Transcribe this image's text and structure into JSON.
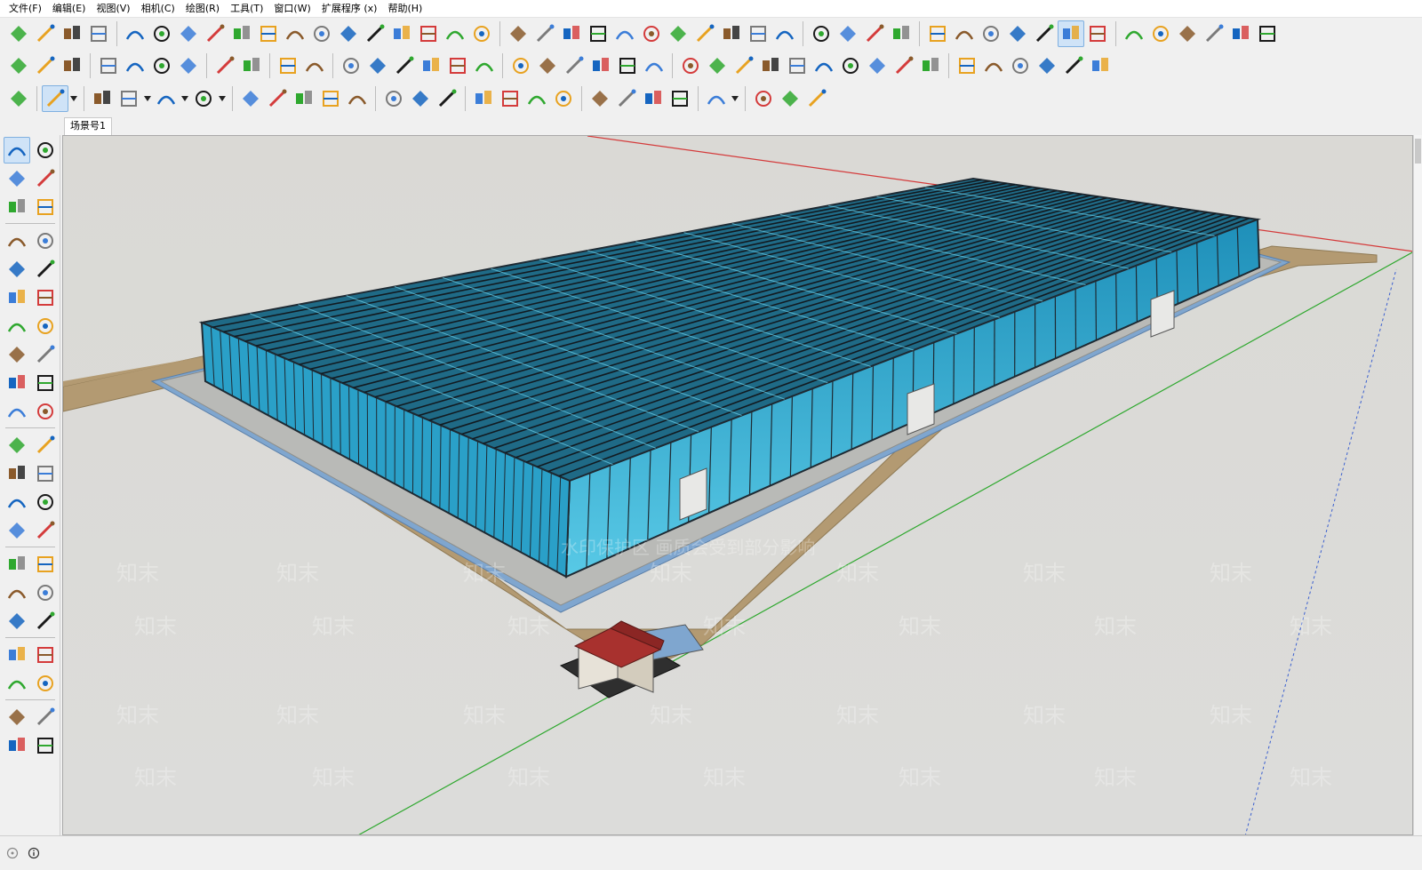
{
  "menu": {
    "items": [
      "文件(F)",
      "编辑(E)",
      "视图(V)",
      "相机(C)",
      "绘图(R)",
      "工具(T)",
      "窗口(W)",
      "扩展程序 (x)",
      "帮助(H)"
    ]
  },
  "scene": {
    "tab_label": "场景号1"
  },
  "watermark": {
    "notice": "水印保护区 画质会受到部分影响",
    "brand": "知末"
  },
  "status": {
    "text": "",
    "measurements_label": "",
    "measurements_value": ""
  },
  "colors": {
    "ground": "#d9d9d7",
    "sand_path": "#b39a72",
    "glass": "#39b6d9",
    "frame": "#2f3640",
    "water": "#8fb6de",
    "red_axis": "#d43b3b",
    "green_axis": "#2fa82f",
    "blue_axis": "#3a5fcf"
  },
  "toolbar_icons": {
    "row1": [
      "style-icon",
      "section-icon",
      "stairs-icon",
      "bars-icon",
      "array-icon",
      "align-icon",
      "bend-icon",
      "explode-icon",
      "arch-icon",
      "loop-icon",
      "scatter-icon",
      "slab-icon",
      "offset-icon",
      "flatten-icon",
      "grid-flip-icon",
      "cube-flip-icon",
      "layers-flip-icon",
      "curve-icon",
      "beads-icon",
      "wave-icon",
      "spiral-icon",
      "edit-box-icon",
      "comb-icon",
      "columns-icon",
      "mirror-icon",
      "dots-grid-icon",
      "cylinder-icon",
      "pin-icon",
      "broom-icon",
      "grid-table-icon",
      "dice-icon",
      "env-icon",
      "mod-icon",
      "cube-blue-icon",
      "cube-white-icon",
      "box-outline-icon",
      "box-white-icon",
      "box-grey-icon",
      "box-layers-icon",
      "box-blue-icon",
      "house-iso-icon",
      "door-icon",
      "home-icon",
      "shop-icon",
      "house-outline-icon",
      "garage-icon"
    ],
    "row2": [
      "new-icon",
      "open-icon",
      "save-icon",
      "cut-icon",
      "copy-icon",
      "paste-icon",
      "erase-icon",
      "undo-icon",
      "redo-icon",
      "print-icon",
      "info-icon",
      "tape-icon",
      "dimension-icon",
      "protractor-icon",
      "text-icon",
      "axes-icon",
      "3dtext-icon",
      "iso-view-icon",
      "top-view-icon",
      "front-view-icon",
      "right-view-icon",
      "back-view-icon",
      "left-view-icon",
      "pencil-icon",
      "freehand-icon",
      "rect-icon",
      "rotated-rect-icon",
      "circle-icon",
      "polygon-icon",
      "arc-icon",
      "arc2-icon",
      "arc3-icon",
      "pie-icon",
      "move-icon",
      "pushpull-icon",
      "rotate-icon",
      "followme-icon",
      "scale-icon",
      "offset-tool-icon"
    ],
    "row3": [
      "zoom-icon",
      "select-icon",
      "eraser-icon",
      "line-icon",
      "arc-tool-icon",
      "shape-icon",
      "pushpull2-icon",
      "followme2-icon",
      "move2-icon",
      "rotate2-icon",
      "scale2-icon",
      "tape2-icon",
      "text2-icon",
      "paint-icon",
      "orbit-icon",
      "pan-icon",
      "zoom2-icon",
      "zoom-extents-icon",
      "section-plane-icon",
      "section-display-icon",
      "section-fill-icon",
      "section-cut-icon",
      "account-icon",
      "extension-warehouse-icon",
      "3d-warehouse-icon",
      "layout-icon"
    ]
  }
}
